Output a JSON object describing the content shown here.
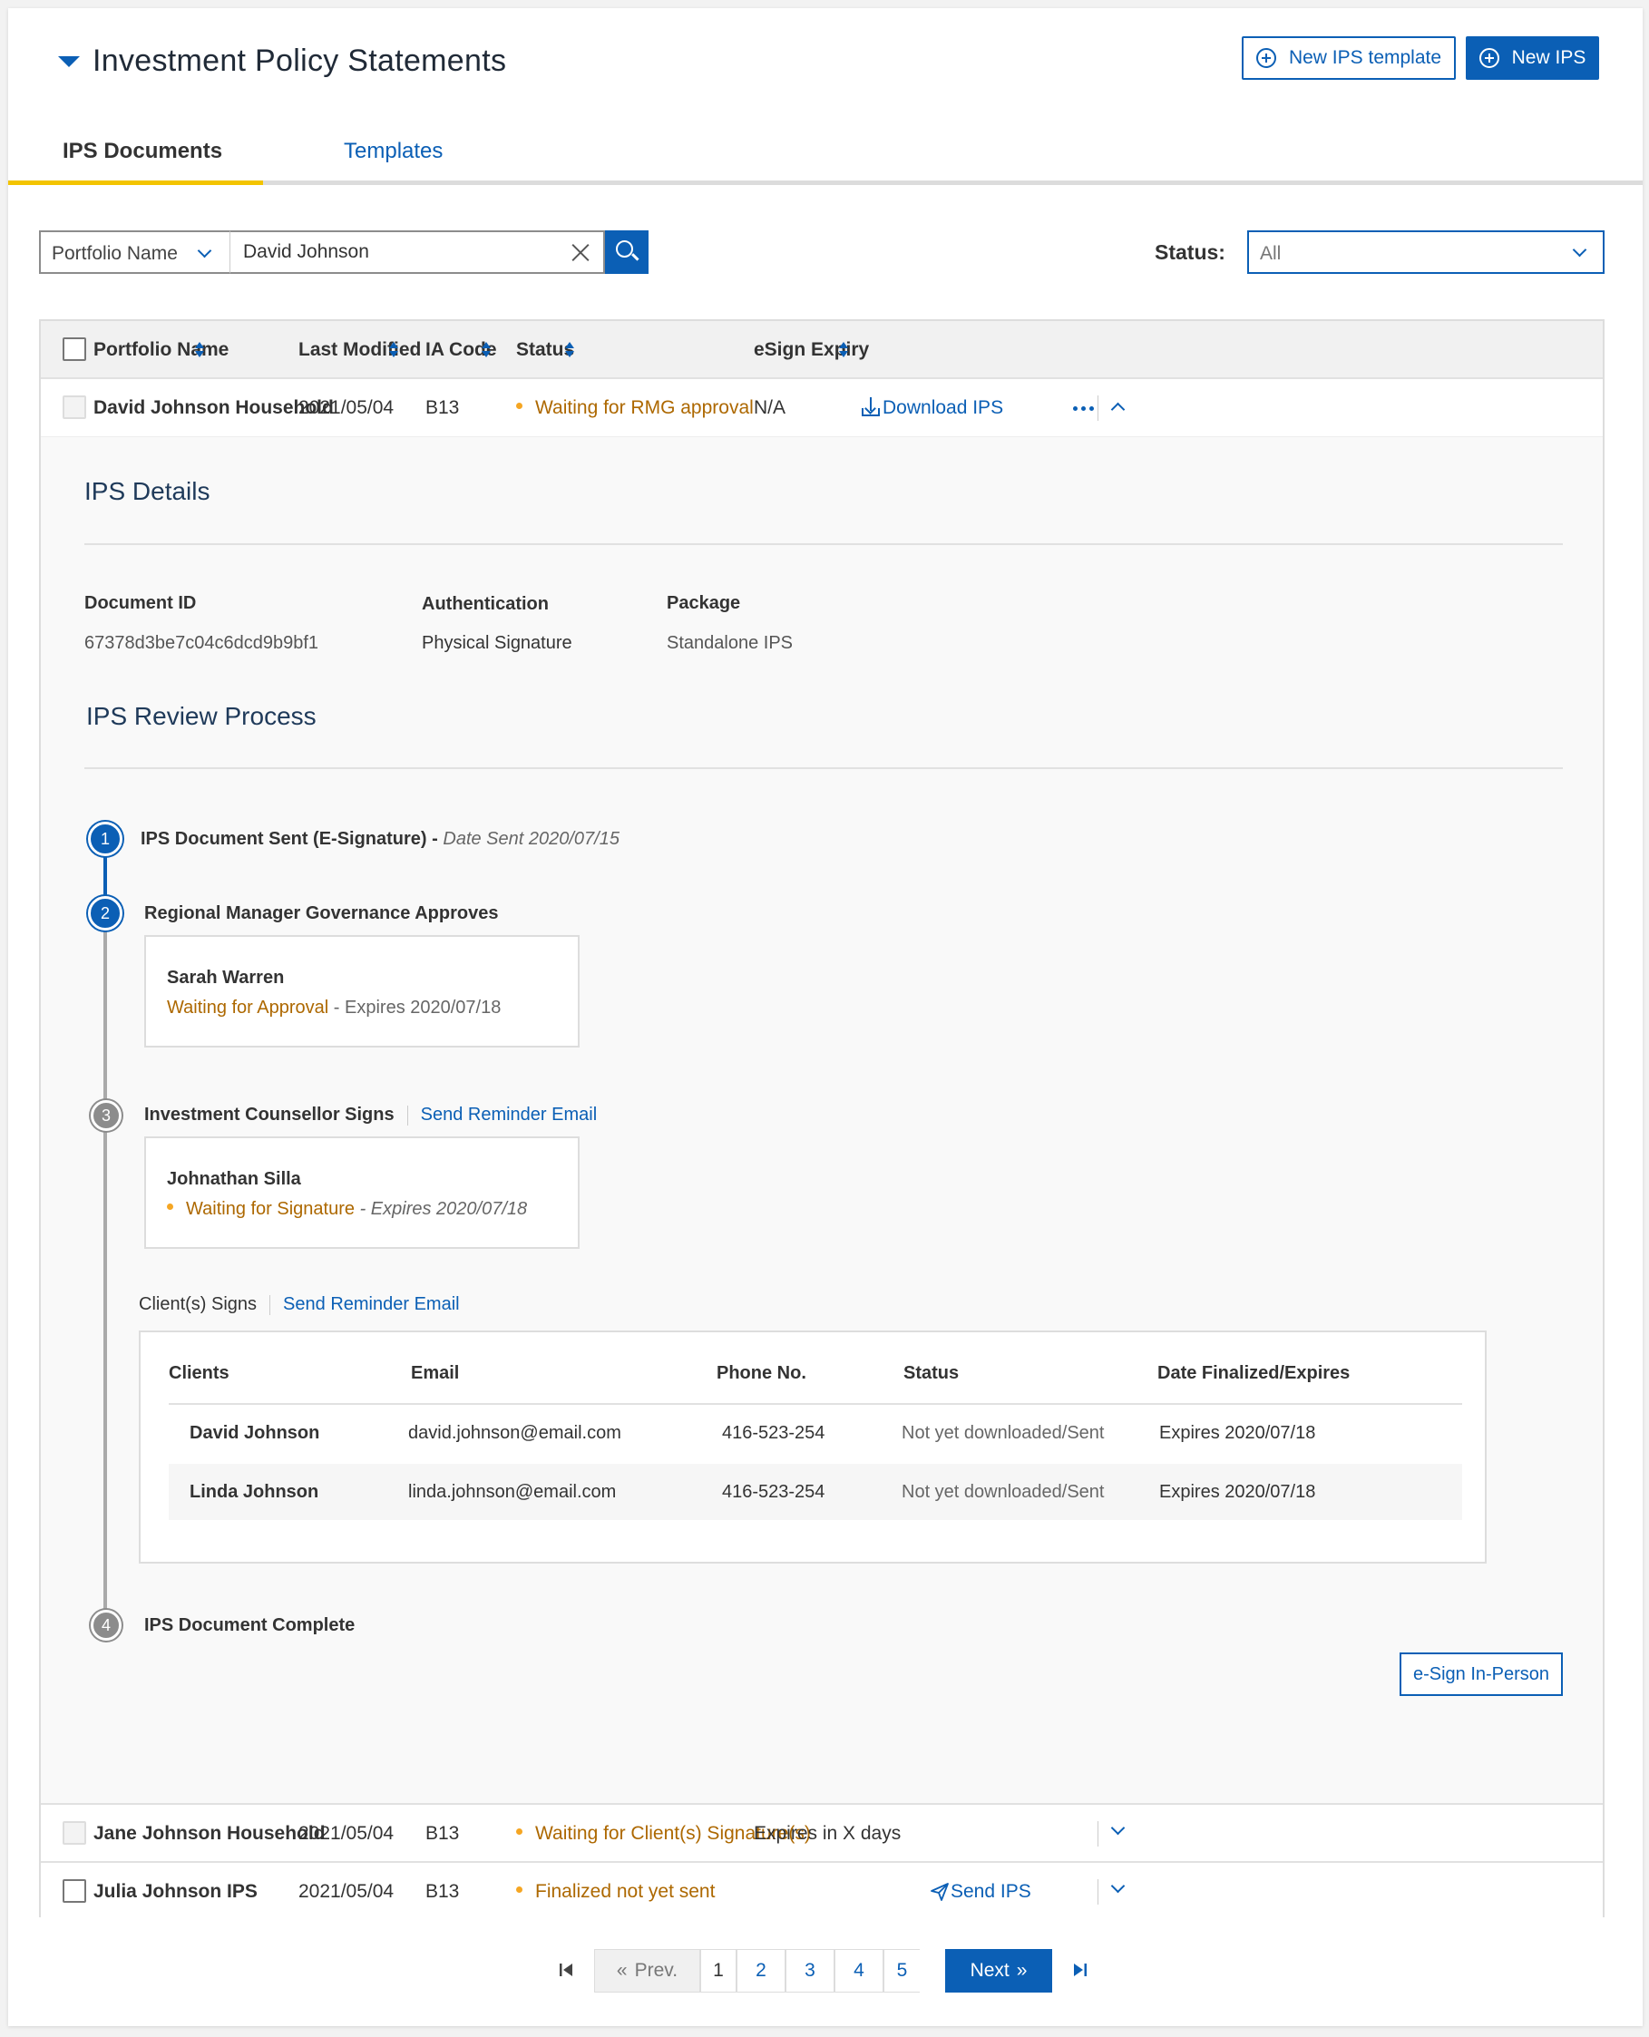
{
  "header": {
    "title": "Investment Policy Statements",
    "new_template_label": "New IPS template",
    "new_ips_label": "New IPS"
  },
  "tabs": [
    {
      "label": "IPS Documents",
      "active": true
    },
    {
      "label": "Templates",
      "active": false
    }
  ],
  "search": {
    "field_select": "Portfolio Name",
    "query": "David Johnson",
    "status_label": "Status:",
    "status_value": "All"
  },
  "table": {
    "columns": [
      "Portfolio Name",
      "Last Modified",
      "IA Code",
      "Status",
      "eSign Expiry"
    ],
    "rows": [
      {
        "portfolio": "David Johnson Household",
        "last_modified": "2021/05/04",
        "ia_code": "B13",
        "status": "Waiting for RMG approval",
        "esign_expiry": "N/A",
        "action": "Download IPS",
        "expanded": true
      },
      {
        "portfolio": "Jane Johnson Household",
        "last_modified": "2021/05/04",
        "ia_code": "B13",
        "status": "Waiting for Client(s) Signature(s)",
        "esign_expiry": "Expires in X days",
        "action": "",
        "expanded": false
      },
      {
        "portfolio": "Julia Johnson IPS",
        "last_modified": "2021/05/04",
        "ia_code": "B13",
        "status": "Finalized not yet sent",
        "esign_expiry": "",
        "action": "Send IPS",
        "expanded": false
      }
    ]
  },
  "details": {
    "title": "IPS Details",
    "fields": [
      {
        "label": "Document ID",
        "value": "67378d3be7c04c6dcd9b9bf1"
      },
      {
        "label": "Authentication",
        "value": "Physical Signature"
      },
      {
        "label": "Package",
        "value": "Standalone IPS"
      }
    ]
  },
  "review": {
    "title": "IPS Review Process",
    "steps": [
      {
        "number": "1",
        "title": "IPS Document Sent (E-Signature) -",
        "date": "Date Sent 2020/07/15"
      },
      {
        "number": "2",
        "title": "Regional Manager Governance Approves"
      },
      {
        "number": "3",
        "title": "Investment Counsellor Signs",
        "action": "Send Reminder Email"
      },
      {
        "number": "4",
        "title": "IPS Document Complete"
      }
    ],
    "approver": {
      "name": "Sarah Warren",
      "status": "Waiting for Approval",
      "expiry": "- Expires 2020/07/18"
    },
    "counsellor": {
      "name": "Johnathan Silla",
      "status": "Waiting for Signature",
      "expiry": "- Expires 2020/07/18"
    },
    "clients_title": "Client(s) Signs",
    "clients_action": "Send Reminder Email",
    "clients_columns": [
      "Clients",
      "Email",
      "Phone No.",
      "Status",
      "Date Finalized/Expires"
    ],
    "clients": [
      {
        "name": "David Johnson",
        "email": "david.johnson@email.com",
        "phone": "416-523-254",
        "status": "Not yet downloaded/Sent",
        "date": "Expires 2020/07/18"
      },
      {
        "name": "Linda Johnson",
        "email": "linda.johnson@email.com",
        "phone": "416-523-254",
        "status": "Not yet downloaded/Sent",
        "date": "Expires 2020/07/18"
      }
    ],
    "esign_in_person": "e-Sign In-Person"
  },
  "pagination": {
    "prev": "Prev.",
    "next": "Next",
    "pages": [
      "1",
      "2",
      "3",
      "4",
      "5"
    ],
    "current": "Next"
  },
  "colors": {
    "primary": "#0b5fb5",
    "accent_tab": "#f3c400",
    "status_orange": "#ad6800",
    "status_dot": "#f5a623"
  }
}
